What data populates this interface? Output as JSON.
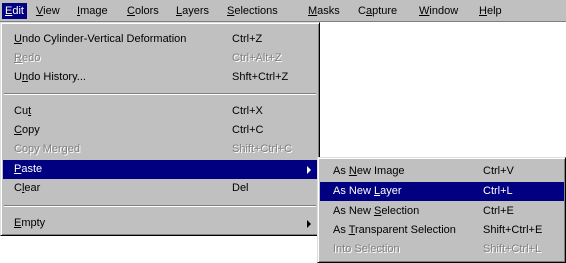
{
  "menubar": {
    "items": [
      {
        "label": "Edit",
        "mnemonic": "E"
      },
      {
        "label": "View",
        "mnemonic": "V"
      },
      {
        "label": "Image",
        "mnemonic": "I"
      },
      {
        "label": "Colors",
        "mnemonic": "C"
      },
      {
        "label": "Layers",
        "mnemonic": "L"
      },
      {
        "label": "Selections",
        "mnemonic": "S"
      },
      {
        "label": "Masks",
        "mnemonic": "M"
      },
      {
        "label": "Capture",
        "mnemonic": "a"
      },
      {
        "label": "Window",
        "mnemonic": "W"
      },
      {
        "label": "Help",
        "mnemonic": "H"
      }
    ],
    "active_index": 0
  },
  "edit_menu": {
    "items": [
      {
        "label": "Undo Cylinder-Vertical Deformation",
        "shortcut": "Ctrl+Z",
        "enabled": true,
        "mnemonic": "U"
      },
      {
        "label": "Redo",
        "shortcut": "Ctrl+Alt+Z",
        "enabled": false,
        "mnemonic": "R"
      },
      {
        "label": "Undo History...",
        "shortcut": "Shft+Ctrl+Z",
        "enabled": true,
        "mnemonic": "n"
      },
      {
        "label": "Cut",
        "shortcut": "Ctrl+X",
        "enabled": true,
        "mnemonic": "t"
      },
      {
        "label": "Copy",
        "shortcut": "Ctrl+C",
        "enabled": true,
        "mnemonic": "C"
      },
      {
        "label": "Copy Merged",
        "shortcut": "Shift+Ctrl+C",
        "enabled": false,
        "mnemonic": ""
      },
      {
        "label": "Paste",
        "shortcut": "",
        "enabled": true,
        "mnemonic": "P",
        "submenu": true,
        "highlighted": true
      },
      {
        "label": "Clear",
        "shortcut": "Del",
        "enabled": true,
        "mnemonic": "l"
      },
      {
        "label": "Empty",
        "shortcut": "",
        "enabled": true,
        "mnemonic": "E",
        "submenu": true
      }
    ]
  },
  "paste_submenu": {
    "items": [
      {
        "label": "As New Image",
        "shortcut": "Ctrl+V",
        "enabled": true,
        "mnemonic": "N"
      },
      {
        "label": "As New Layer",
        "shortcut": "Ctrl+L",
        "enabled": true,
        "mnemonic": "L",
        "highlighted": true
      },
      {
        "label": "As New Selection",
        "shortcut": "Ctrl+E",
        "enabled": true,
        "mnemonic": "S"
      },
      {
        "label": "As Transparent Selection",
        "shortcut": "Shift+Ctrl+E",
        "enabled": true,
        "mnemonic": "T"
      },
      {
        "label": "Into Selection",
        "shortcut": "Shift+Ctrl+L",
        "enabled": false,
        "mnemonic": ""
      }
    ]
  },
  "colors": {
    "menu_face": "#c0c0c0",
    "highlight": "#000080",
    "disabled_text": "#808080"
  }
}
